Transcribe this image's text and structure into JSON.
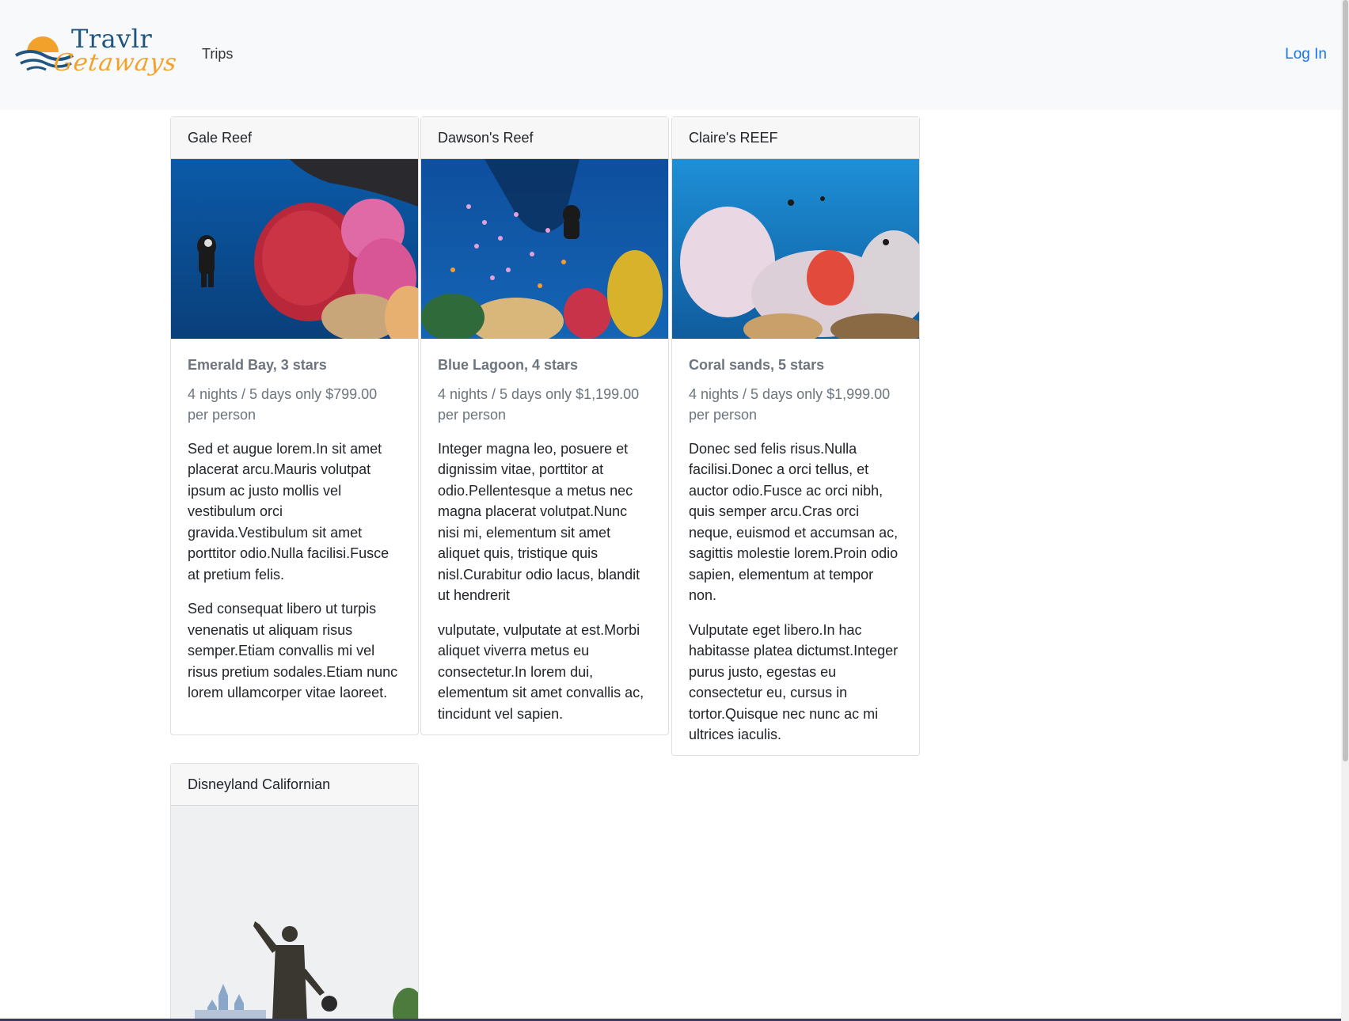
{
  "nav": {
    "brand_word1": "Travlr",
    "brand_word2": "Getaways",
    "trips": "Trips",
    "login": "Log In"
  },
  "colors": {
    "brand_blue": "#20557f",
    "brand_orange": "#f2a22b",
    "link": "#1a73e8",
    "navbar_bg": "#f8f9fa"
  },
  "cards": [
    {
      "header": "Gale Reef",
      "title": "Emerald Bay, 3 stars",
      "subtitle": "4 nights / 5 days only $799.00 per person",
      "p1": "Sed et augue lorem.In sit amet placerat arcu.Mauris volutpat ipsum ac justo mollis vel vestibulum orci gravida.Vestibulum sit amet porttitor odio.Nulla facilisi.Fusce at pretium felis.",
      "p2": "Sed consequat libero ut turpis venenatis ut aliquam risus semper.Etiam convallis mi vel risus pretium sodales.Etiam nunc lorem ullamcorper vitae laoreet.",
      "image": "reef-diver-sea-fan"
    },
    {
      "header": "Dawson's Reef",
      "title": "Blue Lagoon, 4 stars",
      "subtitle": "4 nights / 5 days only $1,199.00 per person",
      "p1": "Integer magna leo, posuere et dignissim vitae, porttitor at odio.Pellentesque a metus nec magna placerat volutpat.Nunc nisi mi, elementum sit amet aliquet quis, tristique quis nisl.Curabitur odio lacus, blandit ut hendrerit",
      "p2": "vulputate, vulputate at est.Morbi aliquet viverra metus eu consectetur.In lorem dui, elementum sit amet convallis ac, tincidunt vel sapien.",
      "image": "reef-diver-fish-school"
    },
    {
      "header": "Claire's REEF",
      "title": "Coral sands, 5 stars",
      "subtitle": "4 nights / 5 days only $1,999.00 per person",
      "p1": "Donec sed felis risus.Nulla facilisi.Donec a orci tellus, et auctor odio.Fusce ac orci nibh, quis semper arcu.Cras orci neque, euismod et accumsan ac, sagittis molestie lorem.Proin odio sapien, elementum at tempor non.",
      "p2": "Vulputate eget libero.In hac habitasse platea dictumst.Integer purus justo, egestas eu consectetur eu, cursus in tortor.Quisque nec nunc ac mi ultrices iaculis.",
      "image": "soft-coral-reef"
    },
    {
      "header": "Disneyland Californian",
      "image": "statue-castle"
    }
  ]
}
